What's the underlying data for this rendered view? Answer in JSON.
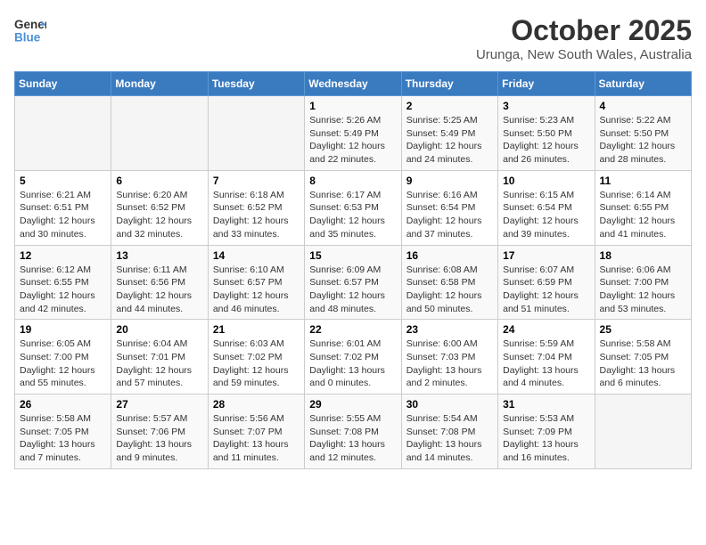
{
  "logo": {
    "line1": "General",
    "line2": "Blue",
    "icon_color": "#4a90d9"
  },
  "title": "October 2025",
  "subtitle": "Urunga, New South Wales, Australia",
  "weekdays": [
    "Sunday",
    "Monday",
    "Tuesday",
    "Wednesday",
    "Thursday",
    "Friday",
    "Saturday"
  ],
  "weeks": [
    [
      {
        "day": "",
        "sunrise": "",
        "sunset": "",
        "daylight": ""
      },
      {
        "day": "",
        "sunrise": "",
        "sunset": "",
        "daylight": ""
      },
      {
        "day": "",
        "sunrise": "",
        "sunset": "",
        "daylight": ""
      },
      {
        "day": "1",
        "sunrise": "Sunrise: 5:26 AM",
        "sunset": "Sunset: 5:49 PM",
        "daylight": "Daylight: 12 hours and 22 minutes."
      },
      {
        "day": "2",
        "sunrise": "Sunrise: 5:25 AM",
        "sunset": "Sunset: 5:49 PM",
        "daylight": "Daylight: 12 hours and 24 minutes."
      },
      {
        "day": "3",
        "sunrise": "Sunrise: 5:23 AM",
        "sunset": "Sunset: 5:50 PM",
        "daylight": "Daylight: 12 hours and 26 minutes."
      },
      {
        "day": "4",
        "sunrise": "Sunrise: 5:22 AM",
        "sunset": "Sunset: 5:50 PM",
        "daylight": "Daylight: 12 hours and 28 minutes."
      }
    ],
    [
      {
        "day": "5",
        "sunrise": "Sunrise: 6:21 AM",
        "sunset": "Sunset: 6:51 PM",
        "daylight": "Daylight: 12 hours and 30 minutes."
      },
      {
        "day": "6",
        "sunrise": "Sunrise: 6:20 AM",
        "sunset": "Sunset: 6:52 PM",
        "daylight": "Daylight: 12 hours and 32 minutes."
      },
      {
        "day": "7",
        "sunrise": "Sunrise: 6:18 AM",
        "sunset": "Sunset: 6:52 PM",
        "daylight": "Daylight: 12 hours and 33 minutes."
      },
      {
        "day": "8",
        "sunrise": "Sunrise: 6:17 AM",
        "sunset": "Sunset: 6:53 PM",
        "daylight": "Daylight: 12 hours and 35 minutes."
      },
      {
        "day": "9",
        "sunrise": "Sunrise: 6:16 AM",
        "sunset": "Sunset: 6:54 PM",
        "daylight": "Daylight: 12 hours and 37 minutes."
      },
      {
        "day": "10",
        "sunrise": "Sunrise: 6:15 AM",
        "sunset": "Sunset: 6:54 PM",
        "daylight": "Daylight: 12 hours and 39 minutes."
      },
      {
        "day": "11",
        "sunrise": "Sunrise: 6:14 AM",
        "sunset": "Sunset: 6:55 PM",
        "daylight": "Daylight: 12 hours and 41 minutes."
      }
    ],
    [
      {
        "day": "12",
        "sunrise": "Sunrise: 6:12 AM",
        "sunset": "Sunset: 6:55 PM",
        "daylight": "Daylight: 12 hours and 42 minutes."
      },
      {
        "day": "13",
        "sunrise": "Sunrise: 6:11 AM",
        "sunset": "Sunset: 6:56 PM",
        "daylight": "Daylight: 12 hours and 44 minutes."
      },
      {
        "day": "14",
        "sunrise": "Sunrise: 6:10 AM",
        "sunset": "Sunset: 6:57 PM",
        "daylight": "Daylight: 12 hours and 46 minutes."
      },
      {
        "day": "15",
        "sunrise": "Sunrise: 6:09 AM",
        "sunset": "Sunset: 6:57 PM",
        "daylight": "Daylight: 12 hours and 48 minutes."
      },
      {
        "day": "16",
        "sunrise": "Sunrise: 6:08 AM",
        "sunset": "Sunset: 6:58 PM",
        "daylight": "Daylight: 12 hours and 50 minutes."
      },
      {
        "day": "17",
        "sunrise": "Sunrise: 6:07 AM",
        "sunset": "Sunset: 6:59 PM",
        "daylight": "Daylight: 12 hours and 51 minutes."
      },
      {
        "day": "18",
        "sunrise": "Sunrise: 6:06 AM",
        "sunset": "Sunset: 7:00 PM",
        "daylight": "Daylight: 12 hours and 53 minutes."
      }
    ],
    [
      {
        "day": "19",
        "sunrise": "Sunrise: 6:05 AM",
        "sunset": "Sunset: 7:00 PM",
        "daylight": "Daylight: 12 hours and 55 minutes."
      },
      {
        "day": "20",
        "sunrise": "Sunrise: 6:04 AM",
        "sunset": "Sunset: 7:01 PM",
        "daylight": "Daylight: 12 hours and 57 minutes."
      },
      {
        "day": "21",
        "sunrise": "Sunrise: 6:03 AM",
        "sunset": "Sunset: 7:02 PM",
        "daylight": "Daylight: 12 hours and 59 minutes."
      },
      {
        "day": "22",
        "sunrise": "Sunrise: 6:01 AM",
        "sunset": "Sunset: 7:02 PM",
        "daylight": "Daylight: 13 hours and 0 minutes."
      },
      {
        "day": "23",
        "sunrise": "Sunrise: 6:00 AM",
        "sunset": "Sunset: 7:03 PM",
        "daylight": "Daylight: 13 hours and 2 minutes."
      },
      {
        "day": "24",
        "sunrise": "Sunrise: 5:59 AM",
        "sunset": "Sunset: 7:04 PM",
        "daylight": "Daylight: 13 hours and 4 minutes."
      },
      {
        "day": "25",
        "sunrise": "Sunrise: 5:58 AM",
        "sunset": "Sunset: 7:05 PM",
        "daylight": "Daylight: 13 hours and 6 minutes."
      }
    ],
    [
      {
        "day": "26",
        "sunrise": "Sunrise: 5:58 AM",
        "sunset": "Sunset: 7:05 PM",
        "daylight": "Daylight: 13 hours and 7 minutes."
      },
      {
        "day": "27",
        "sunrise": "Sunrise: 5:57 AM",
        "sunset": "Sunset: 7:06 PM",
        "daylight": "Daylight: 13 hours and 9 minutes."
      },
      {
        "day": "28",
        "sunrise": "Sunrise: 5:56 AM",
        "sunset": "Sunset: 7:07 PM",
        "daylight": "Daylight: 13 hours and 11 minutes."
      },
      {
        "day": "29",
        "sunrise": "Sunrise: 5:55 AM",
        "sunset": "Sunset: 7:08 PM",
        "daylight": "Daylight: 13 hours and 12 minutes."
      },
      {
        "day": "30",
        "sunrise": "Sunrise: 5:54 AM",
        "sunset": "Sunset: 7:08 PM",
        "daylight": "Daylight: 13 hours and 14 minutes."
      },
      {
        "day": "31",
        "sunrise": "Sunrise: 5:53 AM",
        "sunset": "Sunset: 7:09 PM",
        "daylight": "Daylight: 13 hours and 16 minutes."
      },
      {
        "day": "",
        "sunrise": "",
        "sunset": "",
        "daylight": ""
      }
    ]
  ]
}
